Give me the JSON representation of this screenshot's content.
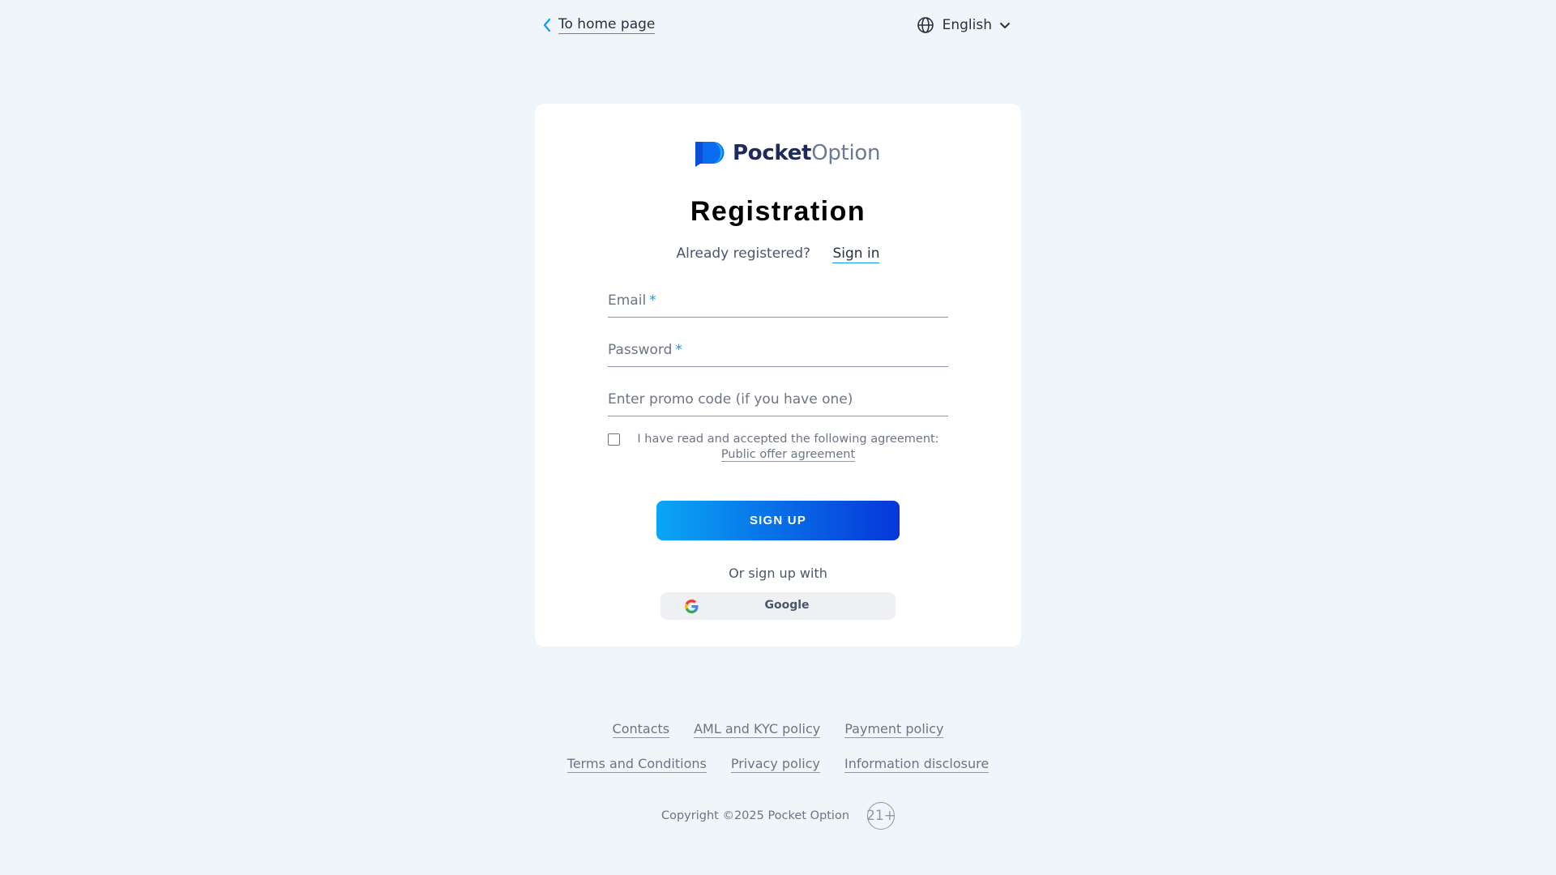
{
  "header": {
    "home_link": "To home page",
    "language": "English"
  },
  "brand": {
    "name_bold": "Pocket",
    "name_light": "Option",
    "color_primary": "#1d2a5b",
    "color_accent": "#0a6cf0"
  },
  "form": {
    "title": "Registration",
    "already_registered": "Already registered?",
    "sign_in": "Sign in",
    "email_placeholder": "Email",
    "password_placeholder": "Password",
    "promo_placeholder": "Enter promo code (if you have one)",
    "required_mark": "*",
    "agreement_text": "I have read and accepted the following agreement:",
    "agreement_link": "Public offer agreement",
    "agreement_checked": false,
    "submit": "SIGN UP",
    "or_sign_up_with": "Or sign up with",
    "google": "Google"
  },
  "footer": {
    "links_row1": [
      "Contacts",
      "AML and KYC policy",
      "Payment policy"
    ],
    "links_row2": [
      "Terms and Conditions",
      "Privacy policy",
      "Information disclosure"
    ],
    "copyright": "Copyright ©2025 Pocket Option",
    "age_badge": "21+"
  }
}
